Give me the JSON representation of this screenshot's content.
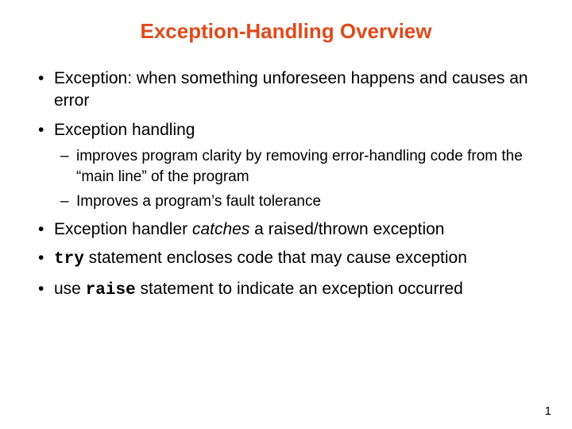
{
  "title": "Exception-Handling Overview",
  "bullets": {
    "b1": "Exception: when something unforeseen happens and causes an error",
    "b2": "Exception handling",
    "b2sub1": "improves program clarity by removing error-handling code from the “main line” of the program",
    "b2sub2": "Improves a program’s fault tolerance",
    "b3_pre": "Exception handler ",
    "b3_em": "catches",
    "b3_post": " a raised/thrown exception",
    "b4_code": "try",
    "b4_rest": " statement encloses code that may cause exception",
    "b5_pre": "use ",
    "b5_code": "raise",
    "b5_post": " statement to indicate an exception occurred"
  },
  "page_number": "1"
}
